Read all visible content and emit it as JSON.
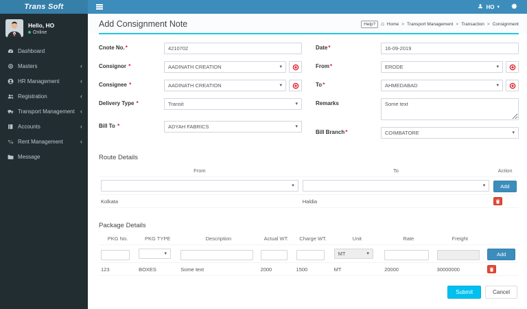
{
  "brand": {
    "name": "Trans Soft"
  },
  "topbar": {
    "user_label": "HO"
  },
  "icons": {
    "caret": "▾",
    "chevron": "‹",
    "home": "⌂",
    "sep": ">"
  },
  "sidebar": {
    "greeting": "Hello, HO",
    "status": "Online",
    "items": [
      {
        "label": "Dashboard"
      },
      {
        "label": "Masters",
        "expandable": true
      },
      {
        "label": "HR Management",
        "expandable": true
      },
      {
        "label": "Registration",
        "expandable": true
      },
      {
        "label": "Transport Management",
        "expandable": true
      },
      {
        "label": "Accounts",
        "expandable": true
      },
      {
        "label": "Rent Management",
        "expandable": true
      },
      {
        "label": "Message"
      }
    ]
  },
  "page": {
    "title": "Add Consignment Note",
    "help_label": "Help?",
    "breadcrumb": [
      "Home",
      "Transport Management",
      "Transaction",
      "Consignment"
    ]
  },
  "form": {
    "cnote": {
      "label": "Cnote No.",
      "req": "*",
      "value": "4210702"
    },
    "date": {
      "label": "Date",
      "req": "*",
      "value": "16-09-2019"
    },
    "consignor": {
      "label": "Consignor",
      "req": "*",
      "value": "AADINATH CREATION"
    },
    "from": {
      "label": "From",
      "req": "*",
      "value": "ERODE"
    },
    "consignee": {
      "label": "Consignee",
      "req": "*",
      "value": "AADINATH CREATION"
    },
    "to": {
      "label": "To",
      "req": "*",
      "value": "AHMEDABAD"
    },
    "delivery_type": {
      "label": "Delivery Type",
      "req": "*",
      "value": "Transit"
    },
    "remarks": {
      "label": "Remarks",
      "value": "Some text"
    },
    "bill_to": {
      "label": "Bill To",
      "req": "*",
      "value": "ADYAH FABRICS"
    },
    "bill_branch": {
      "label": "Bill Branch",
      "req": "*",
      "value": "COIMBATORE"
    }
  },
  "route_details": {
    "title": "Route Details",
    "headers": [
      "From",
      "To",
      "Action"
    ],
    "add_label": "Add",
    "rows": [
      {
        "from": "Kolkata",
        "to": "Haldia"
      }
    ]
  },
  "package_details": {
    "title": "Package Details",
    "headers": [
      "PKG No.",
      "PKG TYPE",
      "Description",
      "Actual WT.",
      "Charge WT.",
      "Unit",
      "Rate",
      "Freight"
    ],
    "unit_default": "MT",
    "add_label": "Add",
    "rows": [
      {
        "pkg_no": "123",
        "pkg_type": "BOXES",
        "description": "Some text",
        "actual_wt": "2000",
        "charge_wt": "1500",
        "unit": "MT",
        "rate": "20000",
        "freight": "30000000"
      }
    ]
  },
  "actions": {
    "submit": "Submit",
    "cancel": "Cancel"
  },
  "colors": {
    "navbar": "#3c8dbc",
    "logo": "#367fa9",
    "sidebar": "#222d32",
    "accent_cyan": "#00c0ef",
    "danger_red": "#dd4b39",
    "add_blue": "#3c8dbc",
    "online_green": "#3dbd7d"
  }
}
